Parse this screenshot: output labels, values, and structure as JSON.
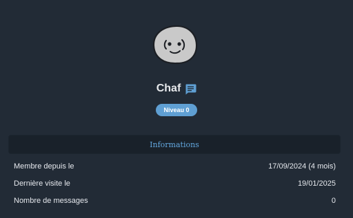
{
  "profile": {
    "username": "Chaf",
    "level_badge": "Niveau 0"
  },
  "info": {
    "header": "Informations",
    "rows": [
      {
        "label": "Membre depuis le",
        "value": "17/09/2024 (4 mois)"
      },
      {
        "label": "Dernière visite le",
        "value": "19/01/2025"
      },
      {
        "label": "Nombre de messages",
        "value": "0"
      }
    ]
  },
  "colors": {
    "background": "#222b36",
    "accent": "#5f9fd3",
    "header_bg": "#19212a",
    "header_text": "#63a8e0"
  },
  "icons": {
    "avatar": "smiling-face-avatar",
    "message": "message-icon"
  }
}
